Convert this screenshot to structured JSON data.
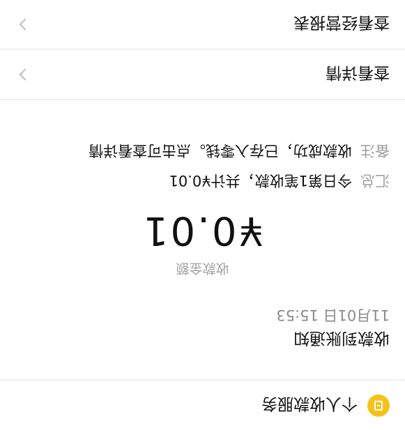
{
  "service": {
    "name": "个人收款服务",
    "icon": "wallet-icon"
  },
  "notice": {
    "title": "收款到账通知",
    "time": "11月01日 15:53",
    "amount_label": "收款金额",
    "amount": "¥0.01",
    "summary_label": "汇总",
    "summary_value": "今日第1笔收款，共计¥0.01",
    "remark_label": "备注",
    "remark_value": "收款成功，已存入零钱。点击可查看详情"
  },
  "links": {
    "detail": "查看详情",
    "report": "查看经营报表"
  },
  "colors": {
    "accent": "#f6c21a",
    "muted": "#a0a0a0",
    "divider": "#e6e6e6"
  }
}
